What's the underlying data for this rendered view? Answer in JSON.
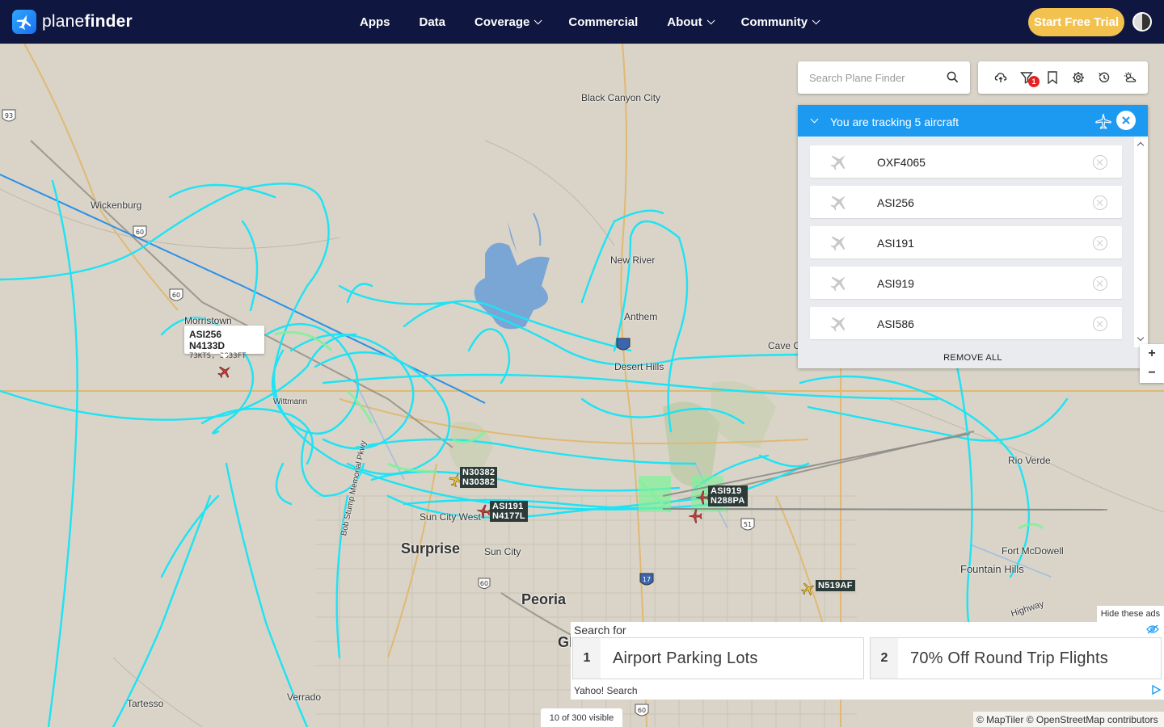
{
  "brand": {
    "name_light": "plane",
    "name_bold": "finder"
  },
  "nav": {
    "items": [
      {
        "label": "Apps",
        "dropdown": false
      },
      {
        "label": "Data",
        "dropdown": false
      },
      {
        "label": "Coverage",
        "dropdown": true
      },
      {
        "label": "Commercial",
        "dropdown": false
      },
      {
        "label": "About",
        "dropdown": true
      },
      {
        "label": "Community",
        "dropdown": true
      }
    ],
    "cta": "Start Free Trial"
  },
  "search": {
    "placeholder": "Search Plane Finder"
  },
  "toolbar": {
    "icons": [
      "cloud-upload-icon",
      "filter-icon",
      "bookmark-icon",
      "settings-icon",
      "history-icon",
      "weather-icon"
    ],
    "filter_badge": "1"
  },
  "tracking": {
    "title": "You are tracking 5 aircraft",
    "items": [
      "OXF4065",
      "ASI256",
      "ASI191",
      "ASI919",
      "ASI586"
    ],
    "remove_all": "REMOVE ALL"
  },
  "zoom": {
    "in": "+",
    "out": "−"
  },
  "map": {
    "places": [
      "Black Canyon City",
      "Wickenburg",
      "New River",
      "Anthem",
      "Morristown",
      "Cave Cr",
      "Desert Hills",
      "Wittmann",
      "Rio Verde",
      "Surprise",
      "Sun City",
      "Sun City West",
      "Peoria",
      "Gl",
      "Fountain Hills",
      "Fort McDowell",
      "Tartesso",
      "Verrado",
      "Bob Stump Memorial Pkwy",
      "Highway"
    ],
    "route_shields": [
      "93",
      "60",
      "60",
      "51",
      "17",
      "60"
    ],
    "popup": {
      "title": "ASI256 N4133D",
      "detail": "73KTS, 3833FT"
    },
    "aircraft_labels": [
      {
        "line1": "N30382",
        "line2": "N30382"
      },
      {
        "line1": "ASI191",
        "line2": "N4177L"
      },
      {
        "line1": "ASI919",
        "line2": "N288PA"
      },
      {
        "line1": "N519AF",
        "line2": ""
      }
    ],
    "visible_count": "10 of 300 visible",
    "attribution": "© MapTiler © OpenStreetMap contributors"
  },
  "ads": {
    "hide": "Hide these ads",
    "search_for": "Search for",
    "items": [
      {
        "num": "1",
        "text": "Airport Parking Lots"
      },
      {
        "num": "2",
        "text": "70% Off Round Trip Flights"
      }
    ],
    "provider": "Yahoo! Search"
  },
  "colors": {
    "nav_bg": "#0f1640",
    "cta": "#f2c14e",
    "panel_header": "#1c9af2",
    "track": "#1de3f5",
    "track_ground": "#7df29a"
  }
}
